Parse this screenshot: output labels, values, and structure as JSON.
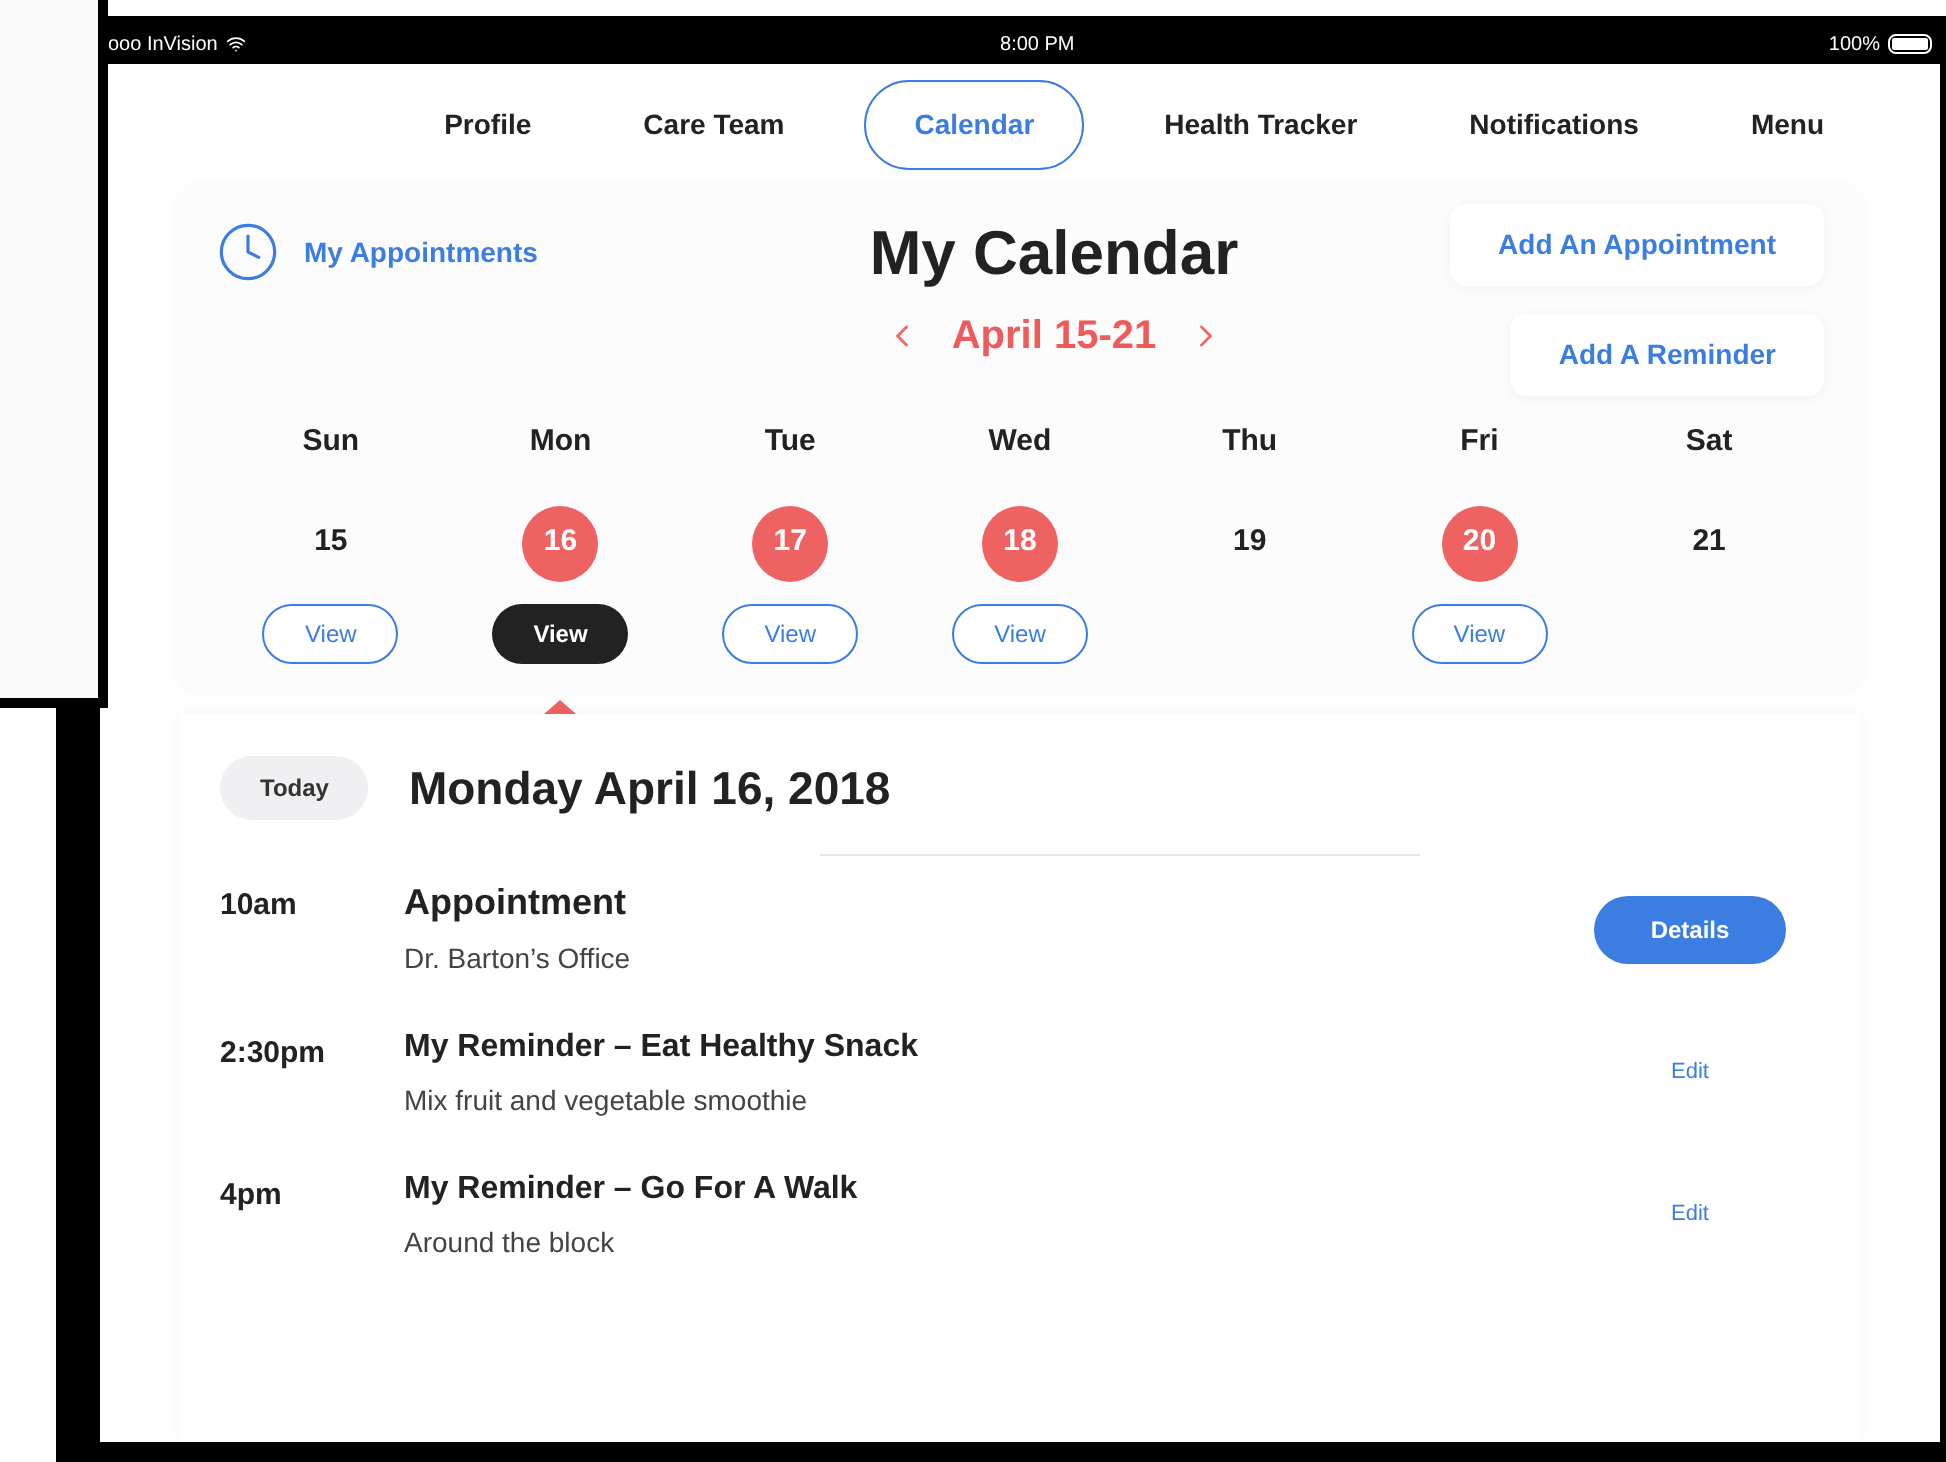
{
  "status_bar": {
    "carrier": "ooo InVision",
    "time": "8:00 PM",
    "battery": "100%"
  },
  "nav": [
    {
      "label": "Profile",
      "selected": false
    },
    {
      "label": "Care Team",
      "selected": false
    },
    {
      "label": "Calendar",
      "selected": true
    },
    {
      "label": "Health Tracker",
      "selected": false
    },
    {
      "label": "Notifications",
      "selected": false
    },
    {
      "label": "Menu",
      "selected": false
    }
  ],
  "my_appointments": "My Appointments",
  "title": "My Calendar",
  "week": "April 15-21",
  "actions": [
    "Add An Appointment",
    "Add A Reminder"
  ],
  "days": [
    {
      "name": "Sun",
      "date": "15",
      "has_events": false,
      "view": "View",
      "selected": false
    },
    {
      "name": "Mon",
      "date": "16",
      "has_events": true,
      "view": "View",
      "selected": true
    },
    {
      "name": "Tue",
      "date": "17",
      "has_events": true,
      "view": "View",
      "selected": false
    },
    {
      "name": "Wed",
      "date": "18",
      "has_events": true,
      "view": "View",
      "selected": false
    },
    {
      "name": "Thu",
      "date": "19",
      "has_events": false
    },
    {
      "name": "Fri",
      "date": "20",
      "has_events": true,
      "view": "View",
      "selected": false
    },
    {
      "name": "Sat",
      "date": "21",
      "has_events": false
    }
  ],
  "today_badge": "Today",
  "day_title": "Monday April 16, 2018",
  "entries": [
    {
      "time": "10am",
      "title": "Appointment",
      "subtitle": "Dr. Barton’s Office",
      "action": {
        "label": "Details",
        "kind": "primary"
      }
    },
    {
      "time": "2:30pm",
      "title": "My Reminder – Eat Healthy Snack",
      "subtitle": "Mix fruit and vegetable smoothie",
      "action": {
        "label": "Edit",
        "kind": "link"
      }
    },
    {
      "time": "4pm",
      "title": "My Reminder – Go For A Walk",
      "subtitle": "Around the block",
      "action": {
        "label": "Edit",
        "kind": "link"
      }
    }
  ]
}
